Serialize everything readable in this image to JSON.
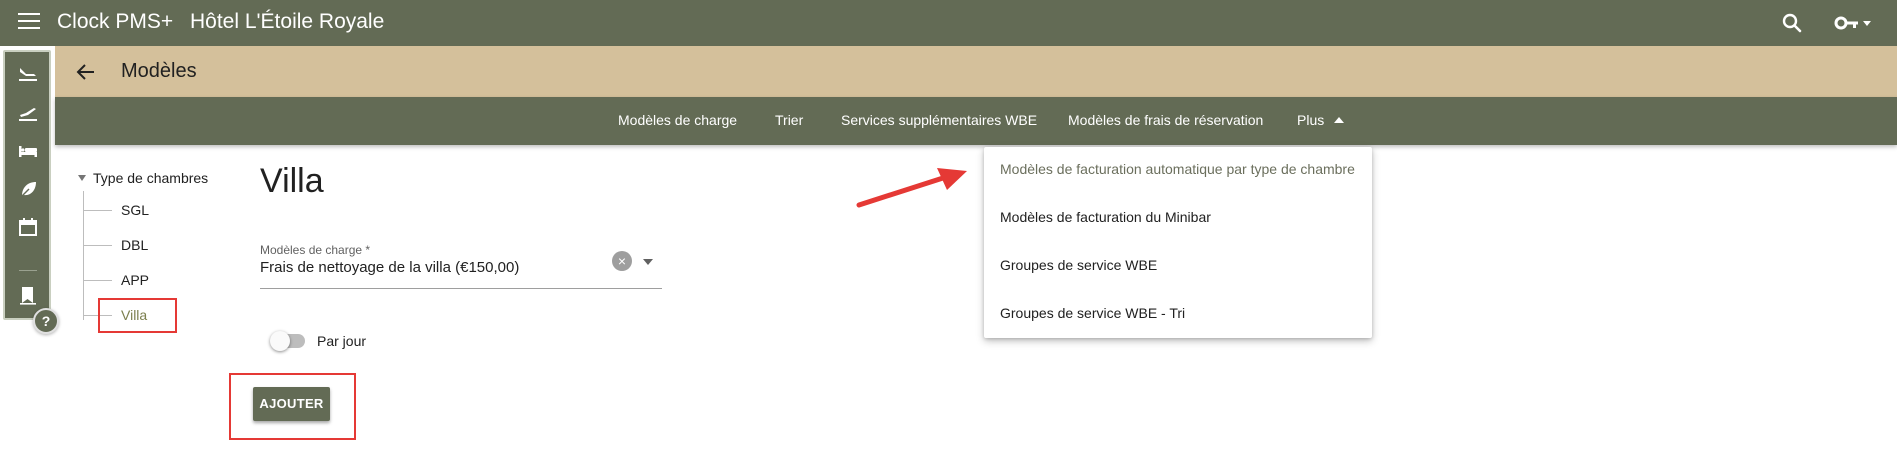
{
  "topbar": {
    "app_name": "Clock PMS+",
    "hotel_name": "Hôtel L'Étoile Royale",
    "background": "#636b55",
    "icons": [
      "menu-icon",
      "search-icon",
      "key-icon"
    ]
  },
  "subheader": {
    "title": "Modèles",
    "background": "#d4c09b"
  },
  "tabs": [
    {
      "label": "Modèles de charge"
    },
    {
      "label": "Trier"
    },
    {
      "label": "Services supplémentaires WBE"
    },
    {
      "label": "Modèles de frais de réservation"
    },
    {
      "label": "Plus"
    }
  ],
  "siderail": {
    "icons": [
      "arrivals-icon",
      "departures-icon",
      "bed-icon",
      "leaf-icon",
      "calendar-icon",
      "bookmark-icon"
    ],
    "help_label": "?"
  },
  "tree": {
    "root_label": "Type de chambres",
    "items": [
      {
        "label": "SGL"
      },
      {
        "label": "DBL"
      },
      {
        "label": "APP"
      },
      {
        "label": "Villa",
        "selected": true
      }
    ]
  },
  "main": {
    "title": "Villa",
    "charge_field": {
      "label": "Modèles de charge *",
      "value": "Frais de nettoyage de la villa (€150,00)"
    },
    "per_day_toggle": {
      "label": "Par jour",
      "checked": false
    },
    "add_button_label": "AJOUTER"
  },
  "plus_menu": {
    "items": [
      {
        "label": "Modèles de facturation automatique par type de chambre",
        "highlighted": true
      },
      {
        "label": "Modèles de facturation du Minibar"
      },
      {
        "label": "Groupes de service WBE"
      },
      {
        "label": "Groupes de service WBE - Tri"
      }
    ]
  },
  "annotation_color": "#e53935"
}
